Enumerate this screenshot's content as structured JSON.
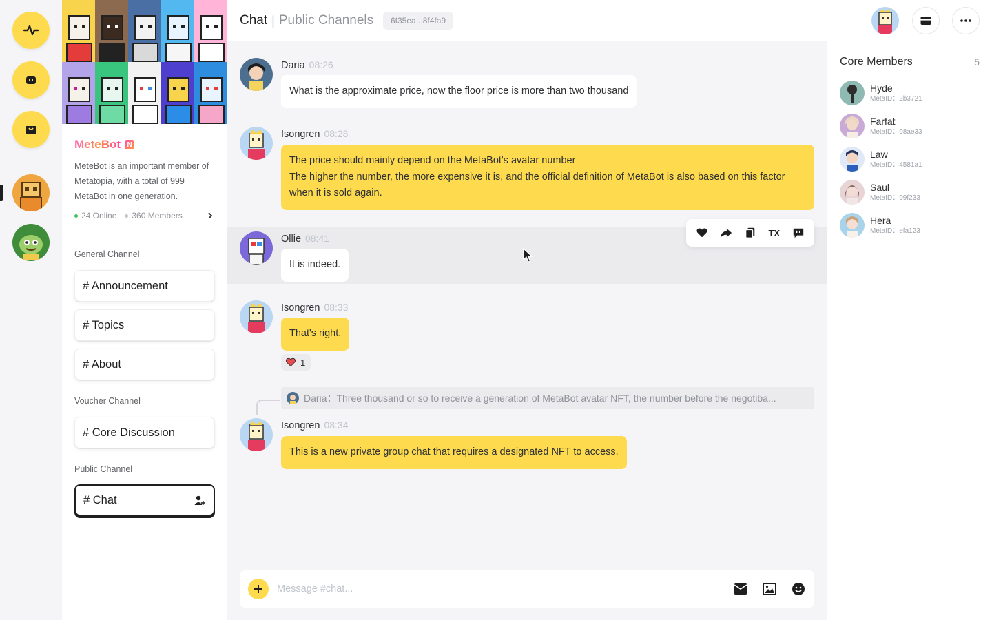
{
  "rail": {
    "items": [
      {
        "icon": "activity-icon"
      },
      {
        "icon": "bot-face-icon"
      },
      {
        "icon": "shopping-bag-icon"
      }
    ],
    "communities": [
      "metebot-community-avatar",
      "green-character-community-avatar"
    ]
  },
  "community": {
    "name": "MeteBot",
    "badge": "N",
    "description": "MeteBot is an important member of Metatopia, with a total of 999 MetaBot in one generation.",
    "online": "24 Online",
    "members": "360 Members",
    "online_color": "#3dc25a",
    "members_color": "#c0c4cc"
  },
  "channel_groups": [
    {
      "title": "General Channel",
      "channels": [
        "# Announcement",
        "# Topics",
        "# About"
      ]
    },
    {
      "title": "Voucher Channel",
      "channels": [
        "# Core Discussion"
      ]
    },
    {
      "title": "Public Channel",
      "channels": [
        "# Chat"
      ]
    }
  ],
  "header": {
    "title": "Chat",
    "separator": "|",
    "subtitle": "Public Channels",
    "chip": "6f35ea...8f4fa9"
  },
  "messages": [
    {
      "name": "Daria",
      "time": "08:26",
      "lines": [
        "What is the approximate price, now the floor price is more than two thousand"
      ],
      "mine": false
    },
    {
      "name": "Isongren",
      "time": "08:28",
      "lines": [
        "The price should mainly depend on the MetaBot's avatar number",
        "The higher the number, the more expensive it is, and the official definition of MetaBot is also based on this factor when it is sold again."
      ],
      "mine": true
    },
    {
      "name": "Ollie",
      "time": "08:41",
      "lines": [
        "It is indeed."
      ],
      "mine": false
    },
    {
      "name": "Isongren",
      "time": "08:33",
      "lines": [
        "That's right."
      ],
      "mine": true,
      "reaction": {
        "emoji": "heart",
        "count": "1"
      }
    },
    {
      "name": "Isongren",
      "time": "08:34",
      "lines": [
        "This is a new private group chat that requires a designated NFT to access."
      ],
      "mine": true,
      "quote": "Daria：Three thousand or so to receive a generation of MetaBot avatar NFT, the number before the negotiba..."
    }
  ],
  "toolbar": {
    "tx_label": "TX",
    "icons": [
      "heart-icon",
      "forward-icon",
      "copy-icon",
      "tx-button",
      "quote-icon"
    ]
  },
  "composer": {
    "placeholder": "Message #chat..."
  },
  "core_members": {
    "title": "Core Members",
    "count": "5",
    "list": [
      {
        "name": "Hyde",
        "id": "MetaID：2b3721"
      },
      {
        "name": "Farfat",
        "id": "MetaID：98ae33"
      },
      {
        "name": "Law",
        "id": "MetaID：4581a1"
      },
      {
        "name": "Saul",
        "id": "MetaID：99f233"
      },
      {
        "name": "Hera",
        "id": "MetaID：efa123"
      }
    ]
  },
  "colors": {
    "accent": "#fedb4e",
    "active_border": "#1f1f1f",
    "reaction_heart": "#e84c4c"
  }
}
